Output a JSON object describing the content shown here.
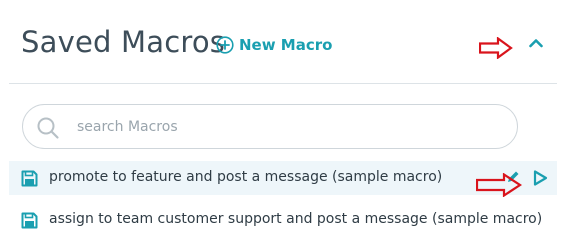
{
  "header": {
    "title": "Saved Macros",
    "new_macro_label": "New Macro"
  },
  "search": {
    "placeholder": "search Macros",
    "value": ""
  },
  "macros": [
    {
      "label": "promote to feature and post a message (sample macro)",
      "selected": true
    },
    {
      "label": "assign to team customer support and post a message (sample macro)",
      "selected": false
    }
  ],
  "icons": {
    "new_macro": "plus-circle-icon",
    "collapse": "chevron-up-icon",
    "search": "search-icon",
    "save": "floppy-disk-icon",
    "edit": "pencil-icon",
    "run": "play-icon",
    "annotation": "red-arrow-icon"
  },
  "colors": {
    "accent": "#1a9fb0",
    "title": "#3d4d59",
    "selected_row_bg": "#eef6fa",
    "annotation": "#d9141c"
  }
}
